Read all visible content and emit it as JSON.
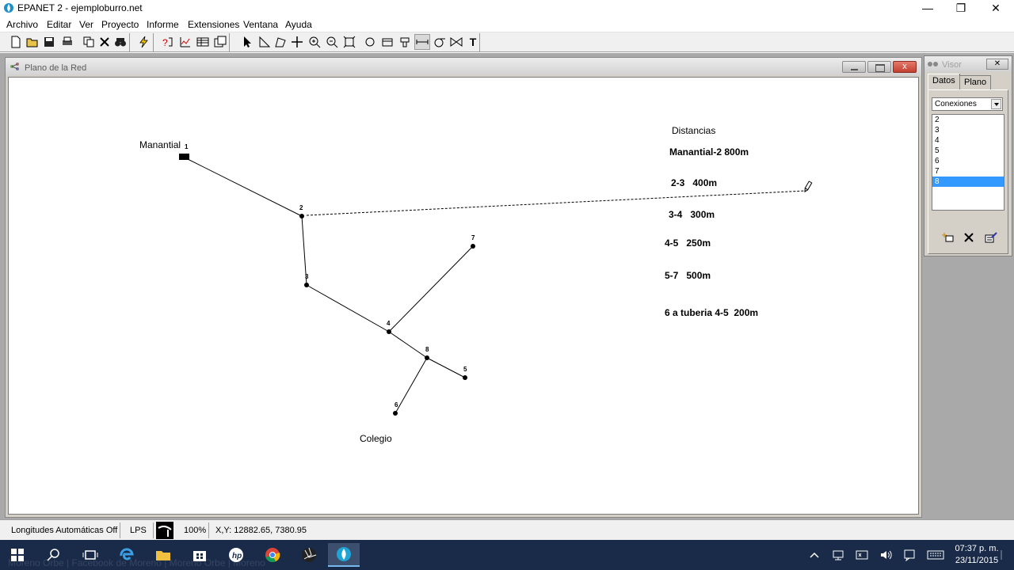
{
  "window": {
    "title": "EPANET 2 - ejemploburro.net",
    "minimize": "—",
    "maximize": "❐",
    "close": "✕"
  },
  "menu": [
    "Archivo",
    "Editar",
    "Ver",
    "Proyecto",
    "Informe",
    "Extensiones",
    "Ventana",
    "Ayuda"
  ],
  "map_window": {
    "title": "Plano de la Red",
    "close_label": "x"
  },
  "map": {
    "labels": {
      "manantial": "Manantial",
      "colegio": "Colegio",
      "distancias": "Distancias",
      "d1": "Manantial-2 800m",
      "d2": "2-3   400m",
      "d3": "3-4   300m",
      "d4": "4-5   250m",
      "d5": "5-7   500m",
      "d6": "6 a tuberia 4-5  200m"
    },
    "node_ids": [
      "1",
      "2",
      "3",
      "4",
      "5",
      "6",
      "7",
      "8"
    ],
    "links": [
      [
        "1",
        "2"
      ],
      [
        "2",
        "3"
      ],
      [
        "3",
        "4"
      ],
      [
        "4",
        "8"
      ],
      [
        "8",
        "5"
      ],
      [
        "8",
        "6"
      ],
      [
        "4",
        "7"
      ]
    ]
  },
  "browser": {
    "title": "Visor",
    "close_label": "✕",
    "tabs": [
      "Datos",
      "Plano"
    ],
    "active_tab": "Datos",
    "category": "Conexiones",
    "items": [
      "2",
      "3",
      "4",
      "5",
      "6",
      "7",
      "8"
    ],
    "selected": "8"
  },
  "statusbar": {
    "auto_length": "Longitudes Automáticas Off",
    "flow_units": "LPS",
    "zoom": "100%",
    "xy": "X,Y: 12882.65, 7380.95"
  },
  "taskbar": {
    "time": "07:37 p. m.",
    "date": "23/11/2015",
    "ghost_text": "Moreno Orbe  |  Facebook de Moreno  |  Moreno Orbe  |  Moreno"
  },
  "colors": {
    "taskbar": "#1a2b4a",
    "selection": "#3399ff"
  }
}
